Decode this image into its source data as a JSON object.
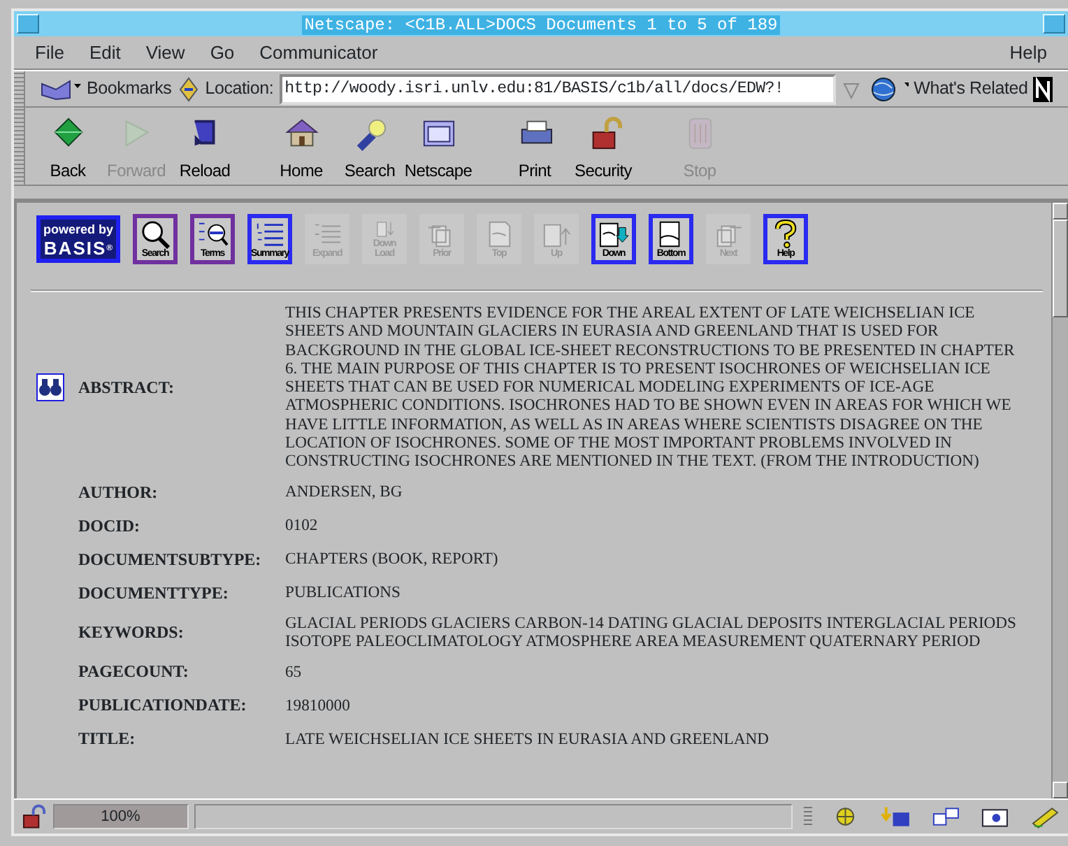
{
  "window": {
    "title": "Netscape: <C1B.ALL>DOCS Documents 1 to 5 of 189"
  },
  "menu": [
    {
      "label": "File"
    },
    {
      "label": "Edit"
    },
    {
      "label": "View"
    },
    {
      "label": "Go"
    },
    {
      "label": "Communicator"
    },
    {
      "label": "Help"
    }
  ],
  "location_bar": {
    "bookmarks": "Bookmarks",
    "location_label": "Location:",
    "url": "http://woody.isri.unlv.edu:81/BASIS/c1b/all/docs/EDW?!",
    "whats_related": "What's Related"
  },
  "nav_toolbar": [
    {
      "label": "Back",
      "kind": "back",
      "enabled": true
    },
    {
      "label": "Forward",
      "kind": "forward",
      "enabled": false
    },
    {
      "label": "Reload",
      "kind": "reload",
      "enabled": true
    },
    {
      "label": "Home",
      "kind": "home",
      "enabled": true
    },
    {
      "label": "Search",
      "kind": "search",
      "enabled": true
    },
    {
      "label": "Netscape",
      "kind": "netscape",
      "enabled": true
    },
    {
      "label": "Print",
      "kind": "print",
      "enabled": true
    },
    {
      "label": "Security",
      "kind": "security",
      "enabled": true
    },
    {
      "label": "Stop",
      "kind": "stop",
      "enabled": false
    }
  ],
  "basis_toolbar": {
    "logo": {
      "top": "powered by",
      "bottom": "BASIS",
      "mark": "®"
    },
    "buttons": [
      {
        "label": "Search",
        "kind": "search",
        "enabled": true,
        "visited": true
      },
      {
        "label": "Terms",
        "kind": "terms",
        "enabled": true,
        "visited": true
      },
      {
        "label": "Summary",
        "kind": "summary",
        "enabled": true,
        "visited": false
      },
      {
        "label": "Expand",
        "kind": "expand",
        "enabled": false,
        "visited": false
      },
      {
        "label": "Down Load",
        "kind": "download",
        "enabled": false,
        "visited": false
      },
      {
        "label": "Prior",
        "kind": "prior",
        "enabled": false,
        "visited": false
      },
      {
        "label": "Top",
        "kind": "top",
        "enabled": false,
        "visited": false
      },
      {
        "label": "Up",
        "kind": "up",
        "enabled": false,
        "visited": false
      },
      {
        "label": "Down",
        "kind": "down",
        "enabled": true,
        "visited": false
      },
      {
        "label": "Bottom",
        "kind": "bottom",
        "enabled": true,
        "visited": false
      },
      {
        "label": "Next",
        "kind": "next",
        "enabled": false,
        "visited": false
      },
      {
        "label": "Help",
        "kind": "help",
        "enabled": true,
        "visited": false
      }
    ]
  },
  "record": [
    {
      "label": "ABSTRACT:",
      "value": "THIS CHAPTER PRESENTS EVIDENCE FOR THE AREAL EXTENT OF LATE WEICHSELIAN ICE SHEETS AND MOUNTAIN GLACIERS IN EURASIA AND GREENLAND THAT IS USED FOR BACKGROUND IN THE GLOBAL ICE-SHEET RECONSTRUCTIONS TO BE PRESENTED IN CHAPTER 6. THE MAIN PURPOSE OF THIS CHAPTER IS TO PRESENT ISOCHRONES OF WEICHSELIAN ICE SHEETS THAT CAN BE USED FOR NUMERICAL MODELING EXPERIMENTS OF ICE-AGE ATMOSPHERIC CONDITIONS. ISOCHRONES HAD TO BE SHOWN EVEN IN AREAS FOR WHICH WE HAVE LITTLE INFORMATION, AS WELL AS IN AREAS WHERE SCIENTISTS DISAGREE ON THE LOCATION OF ISOCHRONES. SOME OF THE MOST IMPORTANT PROBLEMS INVOLVED IN CONSTRUCTING ISOCHRONES ARE MENTIONED IN THE TEXT. (FROM THE INTRODUCTION)",
      "has_icon": true
    },
    {
      "label": "AUTHOR:",
      "value": "ANDERSEN, BG",
      "has_icon": false
    },
    {
      "label": "DOCID:",
      "value": "0102",
      "has_icon": false
    },
    {
      "label": "DOCUMENTSUBTYPE:",
      "value": "CHAPTERS (BOOK, REPORT)",
      "has_icon": false
    },
    {
      "label": "DOCUMENTTYPE:",
      "value": "PUBLICATIONS",
      "has_icon": false
    },
    {
      "label": "KEYWORDS:",
      "value": "GLACIAL PERIODS GLACIERS CARBON-14 DATING GLACIAL DEPOSITS INTERGLACIAL PERIODS ISOTOPE PALEOCLIMATOLOGY ATMOSPHERE AREA MEASUREMENT QUATERNARY PERIOD",
      "has_icon": false
    },
    {
      "label": "PAGECOUNT:",
      "value": "65",
      "has_icon": false
    },
    {
      "label": "PUBLICATIONDATE:",
      "value": "19810000",
      "has_icon": false
    },
    {
      "label": "TITLE:",
      "value": "LATE WEICHSELIAN ICE SHEETS IN EURASIA AND GREENLAND",
      "has_icon": false
    }
  ],
  "status_bar": {
    "zoom": "100%"
  }
}
